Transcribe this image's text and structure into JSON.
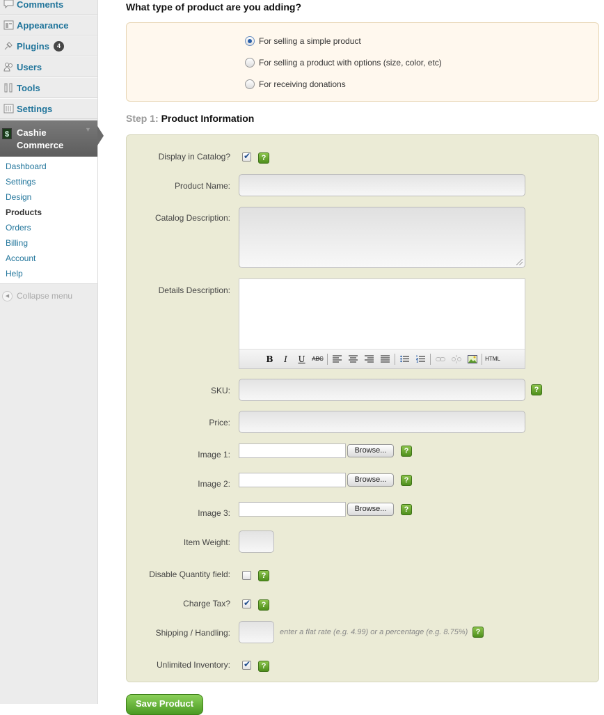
{
  "sidebar": {
    "items": [
      {
        "label": "Comments",
        "icon": "comments-icon"
      },
      {
        "label": "Appearance",
        "icon": "appearance-icon"
      },
      {
        "label": "Plugins",
        "icon": "plugins-icon",
        "badge": "4"
      },
      {
        "label": "Users",
        "icon": "users-icon"
      },
      {
        "label": "Tools",
        "icon": "tools-icon"
      },
      {
        "label": "Settings",
        "icon": "settings-icon"
      }
    ],
    "active": {
      "line1": "Cashie",
      "line2": "Commerce",
      "icon": "dollar-icon"
    },
    "submenu": [
      "Dashboard",
      "Settings",
      "Design",
      "Products",
      "Orders",
      "Billing",
      "Account",
      "Help"
    ],
    "current_submenu": "Products",
    "collapse_label": "Collapse menu"
  },
  "product_type": {
    "question": "What type of product are you adding?",
    "options": [
      {
        "label": "For selling a simple product",
        "selected": true
      },
      {
        "label": "For selling a product with options (size, color, etc)",
        "selected": false
      },
      {
        "label": "For receiving donations",
        "selected": false
      }
    ]
  },
  "step": {
    "num": "Step 1:",
    "title": "Product Information"
  },
  "form": {
    "display_in_catalog": {
      "label": "Display in Catalog?",
      "checked": true
    },
    "product_name": {
      "label": "Product Name:",
      "value": ""
    },
    "catalog_description": {
      "label": "Catalog Description:",
      "value": ""
    },
    "details_description": {
      "label": "Details Description:",
      "value": ""
    },
    "toolbar": [
      "B",
      "I",
      "U",
      "ABC",
      "align-left",
      "align-center",
      "align-right",
      "justify",
      "bullet-list",
      "numbered-list",
      "link",
      "unlink",
      "image",
      "HTML"
    ],
    "sku": {
      "label": "SKU:",
      "value": ""
    },
    "price": {
      "label": "Price:",
      "value": ""
    },
    "image1": {
      "label": "Image 1:"
    },
    "image2": {
      "label": "Image 2:"
    },
    "image3": {
      "label": "Image 3:"
    },
    "browse_label": "Browse...",
    "item_weight": {
      "label": "Item Weight:",
      "value": ""
    },
    "disable_quantity": {
      "label": "Disable Quantity field:",
      "checked": false
    },
    "charge_tax": {
      "label": "Charge Tax?",
      "checked": true
    },
    "shipping": {
      "label": "Shipping / Handling:",
      "value": "",
      "hint": "enter a flat rate (e.g. 4.99) or a percentage (e.g. 8.75%)"
    },
    "unlimited_inventory": {
      "label": "Unlimited Inventory:",
      "checked": true
    },
    "help_glyph": "?"
  },
  "save_label": "Save Product"
}
